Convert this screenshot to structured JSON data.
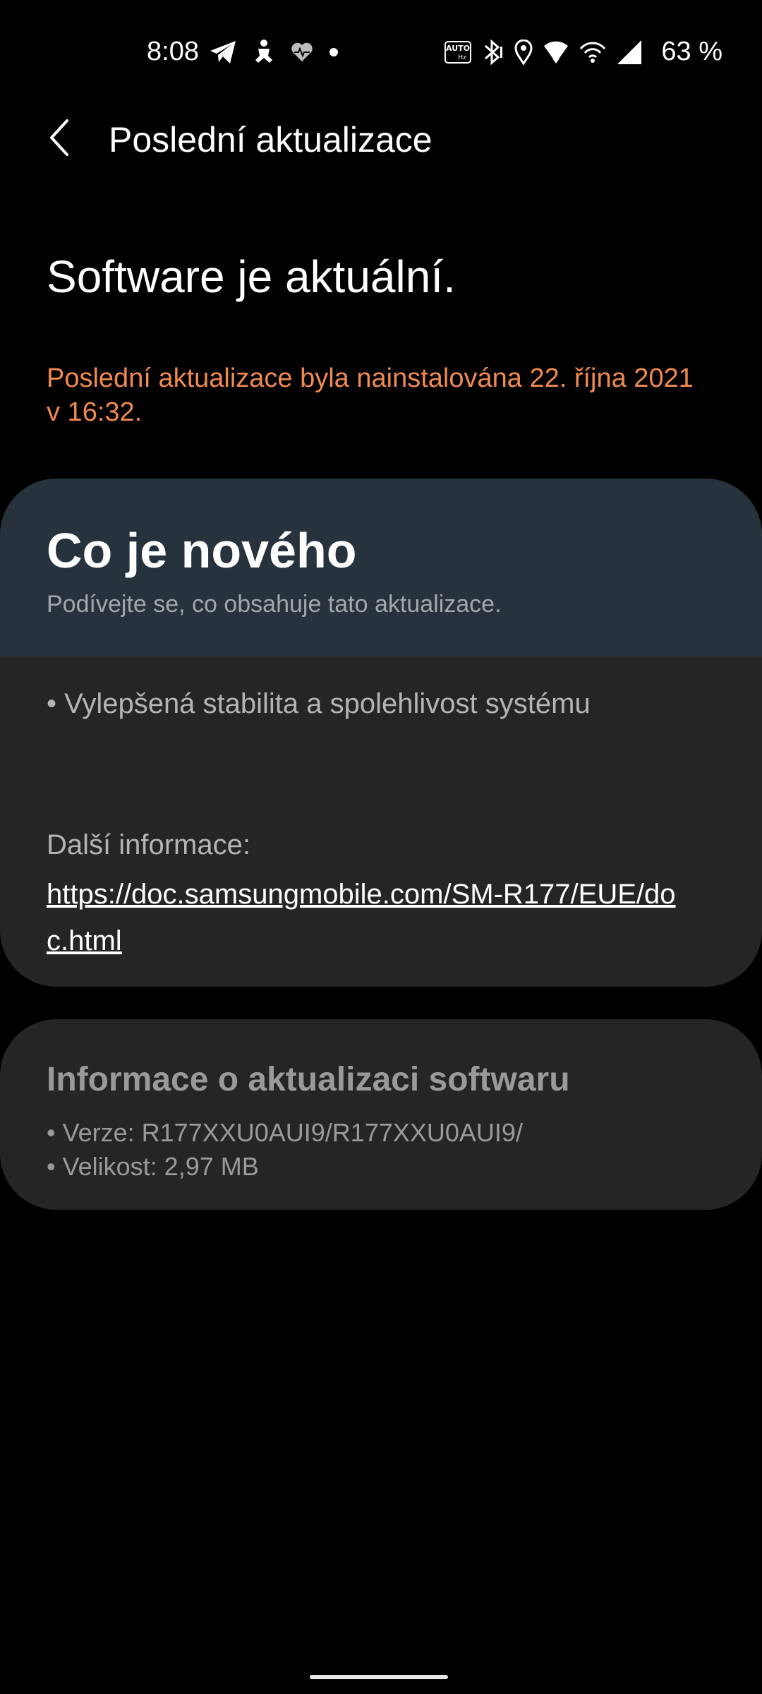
{
  "status_bar": {
    "time": "8:08",
    "battery_text": "63 %",
    "left_icons": [
      "telegram-icon",
      "fitness-figure-icon",
      "heart-rate-icon",
      "notification-dot-icon"
    ],
    "right_icons": [
      "auto-hz-icon",
      "bluetooth-icon",
      "location-icon",
      "wifi-icon",
      "hotspot-icon",
      "cell-signal-icon"
    ]
  },
  "app_bar": {
    "back_icon": "chevron-left-icon",
    "title": "Poslední aktualizace"
  },
  "header": {
    "status": "Software je aktuální.",
    "install_info": "Poslední aktualizace byla nainstalována 22. října 2021 v 16:32.",
    "install_info_color": "#f08a50"
  },
  "whats_new": {
    "title": "Co je nového",
    "subtitle": "Podívejte se, co obsahuje tato aktualizace.",
    "changes": [
      "• Vylepšená stabilita a spolehlivost systému"
    ],
    "more_info_label": "Další informace:",
    "more_info_link": "https://doc.samsungmobile.com/SM-R177/EUE/doc.html",
    "header_color": "#27323d"
  },
  "software_info": {
    "title": "Informace o aktualizaci softwaru",
    "lines": [
      "• Verze: R177XXU0AUI9/R177XXU0AUI9/",
      "• Velikost: 2,97 MB"
    ]
  }
}
